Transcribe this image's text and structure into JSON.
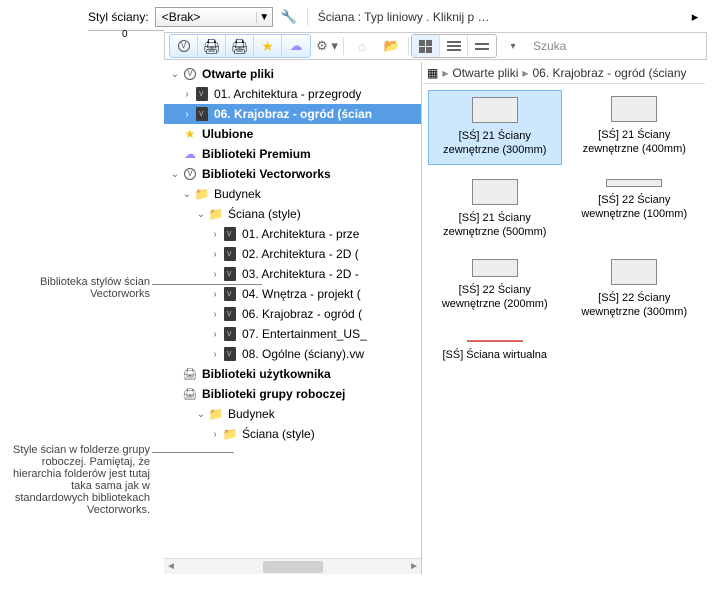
{
  "top": {
    "style_label": "Styl ściany:",
    "dropdown_value": "<Brak>",
    "desc": "Ściana : Typ liniowy . Kliknij p …"
  },
  "ruler": {
    "zero": "0"
  },
  "toolbar2": {
    "search_placeholder": "Szuka"
  },
  "breadcrumb": {
    "root": "Otwarte pliki",
    "leaf": "06. Krajobraz - ogród (ściany"
  },
  "tree": {
    "open_files": "Otwarte pliki",
    "f01": "01. Architektura - przegrody",
    "f06": "06. Krajobraz - ogród (ścian",
    "fav": "Ulubione",
    "premium": "Biblioteki Premium",
    "vwlib": "Biblioteki Vectorworks",
    "budynek": "Budynek",
    "sciana_style": "Ściana (style)",
    "s01": "01. Architektura - prze",
    "s02": "02. Architektura - 2D (",
    "s03": "03. Architektura - 2D -",
    "s04": "04. Wnętrza - projekt (",
    "s06": "06. Krajobraz - ogród (",
    "s07": "07. Entertainment_US_",
    "s08": "08. Ogólne (ściany).vw",
    "userlib": "Biblioteki użytkownika",
    "grouplib": "Biblioteki grupy roboczej",
    "g_budynek": "Budynek",
    "g_sciana": "Ściana (style)"
  },
  "thumbs": {
    "t1": "[SŚ] 21 Ściany zewnętrzne (300mm)",
    "t2": "[SŚ] 21 Ściany zewnętrzne (400mm)",
    "t3": "[SŚ] 21 Ściany zewnętrzne (500mm)",
    "t4": "[SŚ] 22 Ściany wewnętrzne (100mm)",
    "t5": "[SŚ] 22 Ściany wewnętrzne (200mm)",
    "t6": "[SŚ] 22 Ściany wewnętrzne (300mm)",
    "t7": "[SŚ] Ściana wirtualna"
  },
  "anno": {
    "a1": "Biblioteka stylów ścian Vectorworks",
    "a2": "Style ścian w folderze grupy roboczej. Pamiętaj, że hierarchia folderów jest tutaj taka sama jak w standardowych bibliotekach Vectorworks."
  }
}
